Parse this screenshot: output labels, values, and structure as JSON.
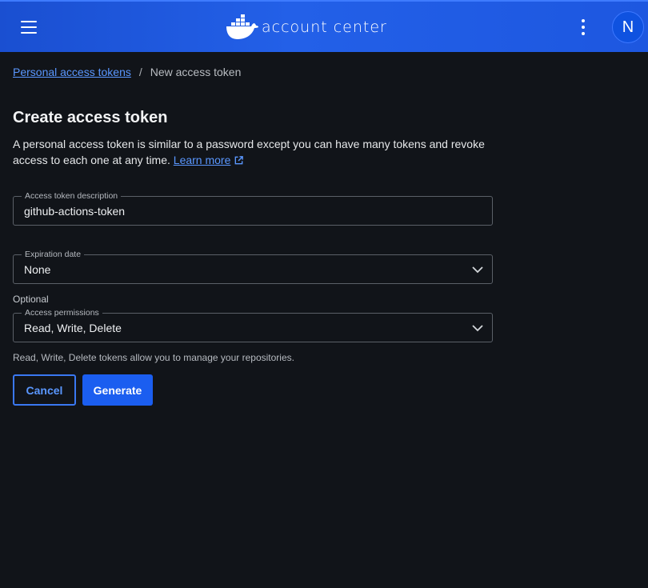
{
  "header": {
    "logo_text": "account center",
    "avatar_initial": "N",
    "brand_color": "#1d57e0"
  },
  "breadcrumb": {
    "parent": "Personal access tokens",
    "separator": "/",
    "current": "New access token"
  },
  "page": {
    "title": "Create access token",
    "description": "A personal access token is similar to a password except you can have many tokens and revoke access to each one at any time.",
    "learn_more": "Learn more"
  },
  "form": {
    "description_field": {
      "label": "Access token description",
      "value": "github-actions-token"
    },
    "expiration": {
      "label": "Expiration date",
      "value": "None"
    },
    "optional_label": "Optional",
    "permissions": {
      "label": "Access permissions",
      "value": "Read, Write, Delete"
    },
    "helper": "Read, Write, Delete tokens allow you to manage your repositories."
  },
  "actions": {
    "cancel": "Cancel",
    "generate": "Generate"
  },
  "icons": [
    "menu-icon",
    "docker-whale-logo",
    "more-vertical-icon",
    "external-link-icon",
    "chevron-down-icon"
  ]
}
